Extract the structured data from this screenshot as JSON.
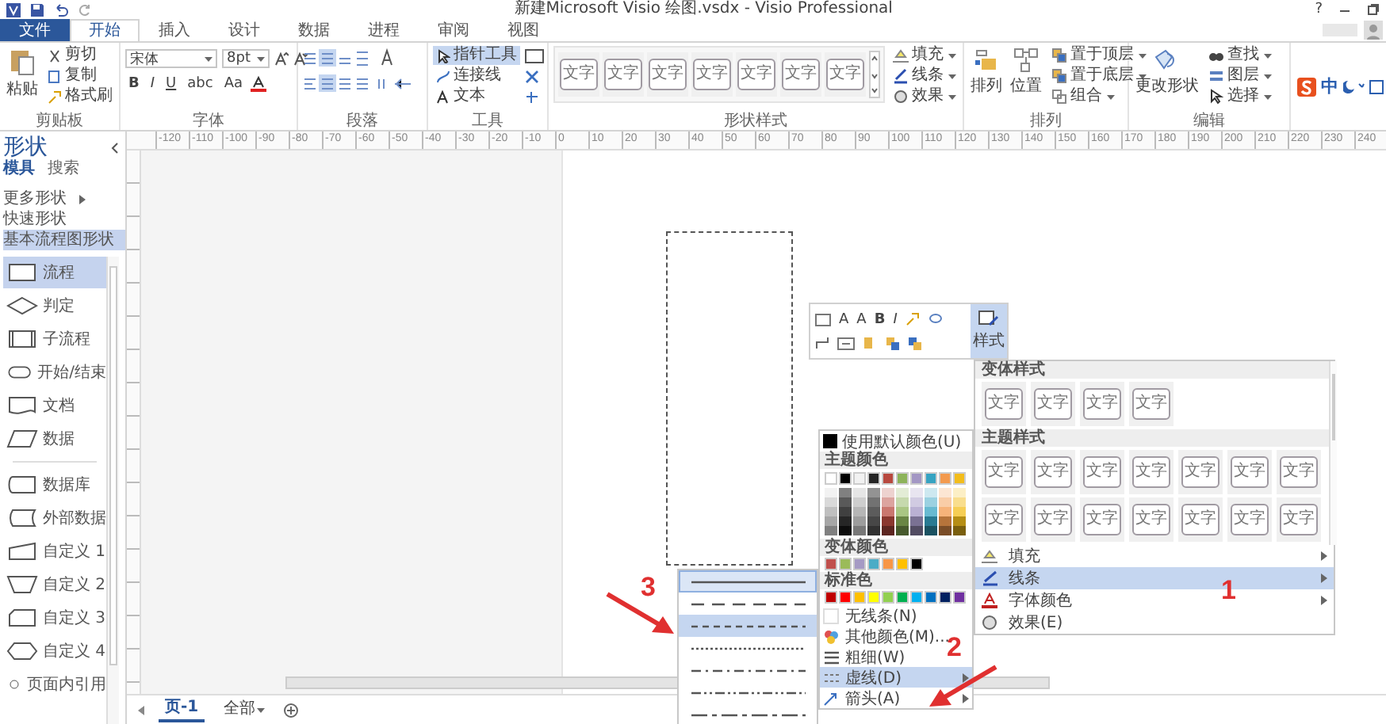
{
  "title_bar": {
    "title": "新建Microsoft Visio 绘图.vsdx - Visio Professional",
    "help": "?"
  },
  "tabs": [
    {
      "label": "文件",
      "kind": "file",
      "selected": false
    },
    {
      "label": "开始",
      "kind": "tab",
      "selected": true
    },
    {
      "label": "插入",
      "kind": "tab",
      "selected": false
    },
    {
      "label": "设计",
      "kind": "tab",
      "selected": false
    },
    {
      "label": "数据",
      "kind": "tab",
      "selected": false
    },
    {
      "label": "进程",
      "kind": "tab",
      "selected": false
    },
    {
      "label": "审阅",
      "kind": "tab",
      "selected": false
    },
    {
      "label": "视图",
      "kind": "tab",
      "selected": false
    }
  ],
  "clipboard": {
    "paste": "粘贴",
    "commands": [
      "剪切",
      "复制",
      "格式刷"
    ],
    "label": "剪贴板"
  },
  "font": {
    "family": "宋体",
    "size": "8pt",
    "styles": [
      "B",
      "I",
      "U",
      "abc",
      "Aa"
    ],
    "label": "字体"
  },
  "paragraph": {
    "label": "段落"
  },
  "tools": {
    "items": [
      {
        "label": "指针工具",
        "selected": true
      },
      {
        "label": "连接线",
        "selected": false
      },
      {
        "label": "文本",
        "selected": false
      }
    ],
    "label": "工具"
  },
  "shape_styles": {
    "tiles": [
      "文字",
      "文字",
      "文字",
      "文字",
      "文字",
      "文字",
      "文字"
    ],
    "commands": [
      "填充",
      "线条",
      "效果"
    ],
    "label": "形状样式"
  },
  "arrange": {
    "large": [
      "排列",
      "位置"
    ],
    "commands": [
      "置于顶层",
      "置于底层",
      "组合"
    ],
    "label": "排列"
  },
  "editing": {
    "large": "更改形状",
    "commands": [
      "查找",
      "图层",
      "选择"
    ],
    "label": "编辑"
  },
  "ime": {
    "label": "中"
  },
  "shapes_panel": {
    "title": "形状",
    "tabs": [
      {
        "label": "模具",
        "selected": true
      },
      {
        "label": "搜索",
        "selected": false
      }
    ],
    "links": [
      {
        "label": "更多形状",
        "expandable": true,
        "selected": false
      },
      {
        "label": "快速形状",
        "expandable": false,
        "selected": false
      },
      {
        "label": "基本流程图形状",
        "expandable": false,
        "selected": true
      }
    ],
    "groups": [
      {
        "items": [
          {
            "label": "流程",
            "kind": "process",
            "selected": true
          },
          {
            "label": "判定",
            "kind": "decision",
            "selected": false
          },
          {
            "label": "子流程",
            "kind": "subprocess",
            "selected": false
          },
          {
            "label": "开始/结束",
            "kind": "terminator",
            "selected": false
          },
          {
            "label": "文档",
            "kind": "document",
            "selected": false
          },
          {
            "label": "数据",
            "kind": "data",
            "selected": false
          }
        ]
      },
      {
        "items": [
          {
            "label": "数据库",
            "kind": "database",
            "selected": false
          },
          {
            "label": "外部数据",
            "kind": "external",
            "selected": false
          },
          {
            "label": "自定义 1",
            "kind": "custom1",
            "selected": false
          },
          {
            "label": "自定义 2",
            "kind": "custom2",
            "selected": false
          },
          {
            "label": "自定义 3",
            "kind": "custom3",
            "selected": false
          },
          {
            "label": "自定义 4",
            "kind": "custom4",
            "selected": false
          },
          {
            "label": "页面内引用",
            "kind": "reference",
            "selected": false
          }
        ]
      }
    ]
  },
  "ruler": {
    "labels": [
      "-120",
      "-110",
      "-100",
      "-90",
      "-80",
      "-70",
      "-60",
      "-50",
      "-40",
      "-30",
      "-20",
      "-10",
      "0",
      "10",
      "20",
      "30",
      "40",
      "50",
      "60",
      "70",
      "80",
      "90",
      "100",
      "110",
      "120",
      "130",
      "140",
      "150",
      "160",
      "170",
      "180",
      "190",
      "200",
      "210",
      "220",
      "230",
      "240"
    ]
  },
  "mini_toolbar": {
    "font_buttons": [
      "A",
      "A",
      "B",
      "I"
    ],
    "style_button": "样式"
  },
  "style_menu": {
    "sections": [
      {
        "title": "变体样式",
        "tiles": [
          "文字",
          "文字",
          "文字",
          "文字"
        ]
      },
      {
        "title": "主题样式",
        "tiles": [
          "文字",
          "文字",
          "文字",
          "文字",
          "文字",
          "文字",
          "文字",
          "文字",
          "文字",
          "文字",
          "文字",
          "文字",
          "文字",
          "文字"
        ]
      }
    ],
    "items": [
      {
        "label": "填充",
        "kind": "fill",
        "selected": false,
        "submenu": true
      },
      {
        "label": "线条",
        "kind": "line",
        "selected": true,
        "submenu": true
      },
      {
        "label": "字体颜色",
        "kind": "font-color",
        "selected": false,
        "submenu": true
      },
      {
        "label": "效果(E)",
        "kind": "effects",
        "selected": false,
        "submenu": false
      }
    ]
  },
  "line_menu": {
    "default_color": "使用默认颜色(U)",
    "theme_header": "主题颜色",
    "theme_colors": [
      {
        "color": "#ffffff"
      },
      {
        "color": "#000000"
      },
      {
        "color": "#f2f2f2"
      },
      {
        "color": "#262626"
      },
      {
        "color": "#b8493f"
      },
      {
        "color": "#8db35a"
      },
      {
        "color": "#a397c4"
      },
      {
        "color": "#36a3c2"
      },
      {
        "color": "#f39a4e"
      },
      {
        "color": "#f3bd1c"
      }
    ],
    "variant_header": "变体颜色",
    "variant_colors": [
      {
        "color": "#c0504d"
      },
      {
        "color": "#9bbb59"
      },
      {
        "color": "#a59ac4"
      },
      {
        "color": "#4bacc6"
      },
      {
        "color": "#f79646"
      },
      {
        "color": "#ffc000"
      },
      {
        "color": "#000000"
      }
    ],
    "standard_header": "标准色",
    "standard_colors": [
      {
        "color": "#c00000"
      },
      {
        "color": "#ff0000"
      },
      {
        "color": "#ffc000"
      },
      {
        "color": "#ffff00"
      },
      {
        "color": "#92d050"
      },
      {
        "color": "#00b050"
      },
      {
        "color": "#00b0f0"
      },
      {
        "color": "#0070c0"
      },
      {
        "color": "#002060"
      },
      {
        "color": "#7030a0"
      }
    ],
    "items": [
      {
        "label": "无线条(N)",
        "kind": "none",
        "selected": false,
        "submenu": false
      },
      {
        "label": "其他颜色(M)...",
        "kind": "more-colors",
        "selected": false,
        "submenu": false
      },
      {
        "label": "粗细(W)",
        "kind": "weight",
        "selected": false,
        "submenu": false
      },
      {
        "label": "虚线(D)",
        "kind": "dash",
        "selected": true,
        "submenu": true
      },
      {
        "label": "箭头(A)",
        "kind": "arrow",
        "selected": false,
        "submenu": true
      }
    ]
  },
  "dash_menu": {
    "styles": [
      {
        "kind": "solid",
        "selected": true,
        "hovered": false
      },
      {
        "kind": "longdash",
        "selected": false,
        "hovered": false
      },
      {
        "kind": "dash",
        "selected": false,
        "hovered": true
      },
      {
        "kind": "dot",
        "selected": false,
        "hovered": false
      },
      {
        "kind": "dashdot",
        "selected": false,
        "hovered": false
      },
      {
        "kind": "dashdotdot",
        "selected": false,
        "hovered": false
      },
      {
        "kind": "longdashdot",
        "selected": false,
        "hovered": false
      }
    ]
  },
  "page_tabs": [
    {
      "label": "页-1",
      "kind": "page",
      "selected": true
    },
    {
      "label": "全部",
      "kind": "dropdown",
      "selected": false
    }
  ],
  "annotations": [
    {
      "label": "3",
      "kind": "arrow"
    },
    {
      "label": "2",
      "kind": "arrow"
    },
    {
      "label": "1",
      "kind": "plain"
    }
  ]
}
